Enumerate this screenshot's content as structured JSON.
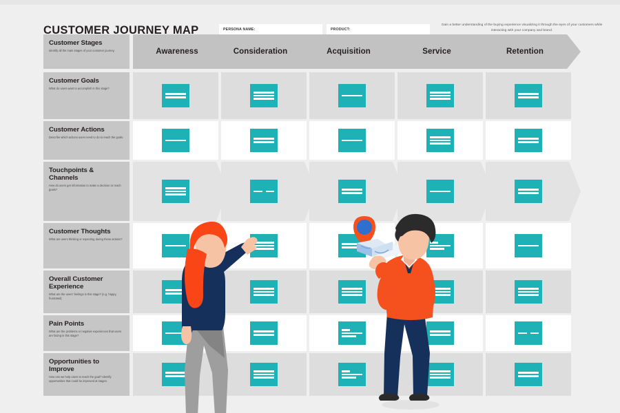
{
  "header": {
    "title": "CUSTOMER JOURNEY MAP",
    "persona_label": "PERSONA NAME:",
    "persona_value": "",
    "persona_placeholder": "",
    "product_label": "PRODUCT:",
    "product_value": "",
    "product_placeholder": "",
    "blurb": "Gain a better understanding of the buying experience visualizing it through the eyes of your customers while interacting with your company and brand."
  },
  "colors": {
    "teal": "#1eb1b5",
    "row_label_gray": "#c6c6c6",
    "stage_gray": "#c2c2c2",
    "cell_gray": "#dddddd",
    "cell_white": "#ffffff",
    "page_bg": "#efefef",
    "orange": "#f4511e",
    "navy": "#16305c",
    "hair_orange": "#fa4616",
    "pants_gray": "#9e9e9e"
  },
  "stages": [
    {
      "label": "Awareness"
    },
    {
      "label": "Consideration"
    },
    {
      "label": "Acquisition"
    },
    {
      "label": "Service"
    },
    {
      "label": "Retention"
    }
  ],
  "rows": [
    {
      "title": "Customer Stages",
      "desc": "Identify all the main stages of your customer journey.",
      "style": "stages"
    },
    {
      "title": "Customer Goals",
      "desc": "What do users want to accomplish in this stage?",
      "style": "gray",
      "notes": [
        "two",
        "three",
        "one",
        "three",
        "two"
      ]
    },
    {
      "title": "Customer Actions",
      "desc": "Describe which actions users need to do to reach the goals.",
      "style": "white",
      "notes": [
        "one",
        "two",
        "one",
        "three",
        "two"
      ]
    },
    {
      "title": "Touchpoints & Channels",
      "desc": "How do users get information to make a decision or reach goals?",
      "style": "chevron",
      "notes": [
        "three",
        "split",
        "two",
        "one",
        "two"
      ]
    },
    {
      "title": "Customer Thoughts",
      "desc": "What are users thinking or expecting during these actions?",
      "style": "white",
      "notes": [
        "one",
        "three",
        "two",
        "mixed",
        "one"
      ]
    },
    {
      "title": "Overall Customer Experience",
      "desc": "What are the users' feelings in this stage? (e.g. happy, frustrated)",
      "style": "gray",
      "notes": [
        "two",
        "three",
        "three",
        "three",
        "three"
      ]
    },
    {
      "title": "Pain Points",
      "desc": "What are the problems or negative experiences that users are facing in this stage?",
      "style": "white",
      "notes": [
        "one",
        "two",
        "mixed",
        "two",
        "split"
      ]
    },
    {
      "title": "Opportunities to Improve",
      "desc": "How can we help users to reach the goal? Identify opportunities that could be improved at stages.",
      "style": "gray",
      "notes": [
        "two",
        "three",
        "mixed",
        "three",
        "two"
      ]
    }
  ],
  "illustrations": [
    {
      "name": "woman-pointing",
      "hair": "#fa4616",
      "top": "#16305c",
      "pants": "#9e9e9e"
    },
    {
      "name": "man-with-map",
      "sweater": "#f4511e",
      "pants": "#16305c",
      "hair": "#2b2b2b"
    }
  ],
  "map_pin": {
    "outer": "#f4511e",
    "inner": "#2f6fd0"
  }
}
